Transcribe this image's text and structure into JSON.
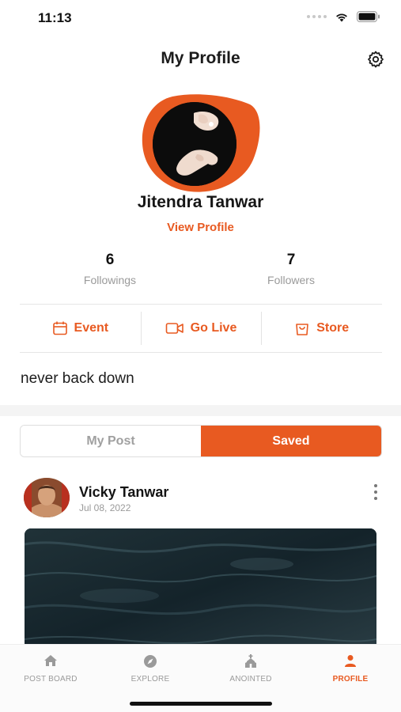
{
  "status_bar": {
    "time": "11:13"
  },
  "header": {
    "title": "My Profile"
  },
  "profile": {
    "name": "Jitendra Tanwar",
    "view_profile_label": "View Profile",
    "bio": "never back down"
  },
  "stats": [
    {
      "value": "6",
      "label": "Followings"
    },
    {
      "value": "7",
      "label": "Followers"
    }
  ],
  "actions": [
    {
      "label": "Event",
      "icon": "calendar-icon"
    },
    {
      "label": "Go Live",
      "icon": "video-camera-icon"
    },
    {
      "label": "Store",
      "icon": "shopping-bag-icon"
    }
  ],
  "segments": {
    "my_post": "My Post",
    "saved": "Saved",
    "selected": "Saved"
  },
  "post": {
    "author": "Vicky Tanwar",
    "date": "Jul 08, 2022"
  },
  "tabbar": [
    {
      "label": "POST BOARD",
      "icon": "home-icon",
      "active": false
    },
    {
      "label": "EXPLORE",
      "icon": "compass-icon",
      "active": false
    },
    {
      "label": "ANOINTED",
      "icon": "church-icon",
      "active": false
    },
    {
      "label": "PROFILE",
      "icon": "person-icon",
      "active": true
    }
  ],
  "colors": {
    "accent": "#e85a21",
    "muted": "#9a9a9a"
  }
}
